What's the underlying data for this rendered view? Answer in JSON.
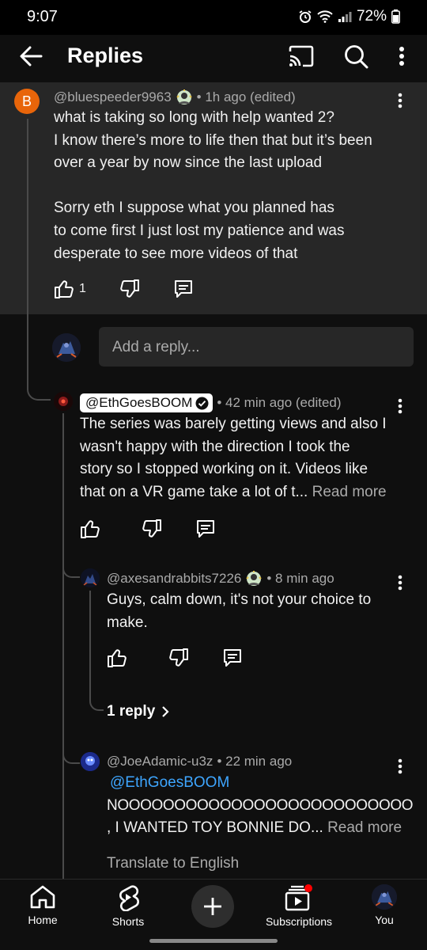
{
  "status_bar": {
    "time": "9:07",
    "battery": "72%"
  },
  "header": {
    "title": "Replies"
  },
  "main_comment": {
    "avatar_letter": "B",
    "author": "@bluespeeder9963",
    "time": "• 1h ago (edited)",
    "lines": [
      "what is taking so long with help wanted 2?",
      "I know there’s more to life then that but it’s been",
      "over a year by now since the last upload",
      "",
      "Sorry eth I suppose what you planned has",
      "to come first I just lost my patience and was",
      "desperate to see more videos of that"
    ],
    "like_count": "1"
  },
  "reply_input": {
    "placeholder": "Add a reply..."
  },
  "replies": [
    {
      "author": "@EthGoesBOOM",
      "time": "• 42 min ago (edited)",
      "lines": [
        "The series was barely getting views and also I",
        "wasn't happy with the direction I took the",
        "story so I stopped working on it. Videos like",
        "that on a VR game take a lot of t..."
      ],
      "read_more": "Read more"
    },
    {
      "author": "@axesandrabbits7226",
      "time": "• 8 min ago",
      "lines": [
        "Guys, calm down, it's not your choice to",
        "make."
      ],
      "replies_link": "1 reply"
    },
    {
      "author": "@JoeAdamic-u3z",
      "time": "• 22 min ago",
      "mention": "@EthGoesBOOM",
      "lines": [
        "NOOOOOOOOOOOOOOOOOOOOOOOOOO",
        ", I WANTED TOY BONNIE DO..."
      ],
      "read_more": "Read more",
      "translate": "Translate to English"
    }
  ],
  "bottom_nav": {
    "home": "Home",
    "shorts": "Shorts",
    "subscriptions": "Subscriptions",
    "you": "You"
  },
  "colors": {
    "background": "#0f0f0f",
    "highlight": "#272727",
    "accent_link": "#3ea6ff",
    "avatar_orange": "#e8650a",
    "notification_red": "#ff0000"
  }
}
